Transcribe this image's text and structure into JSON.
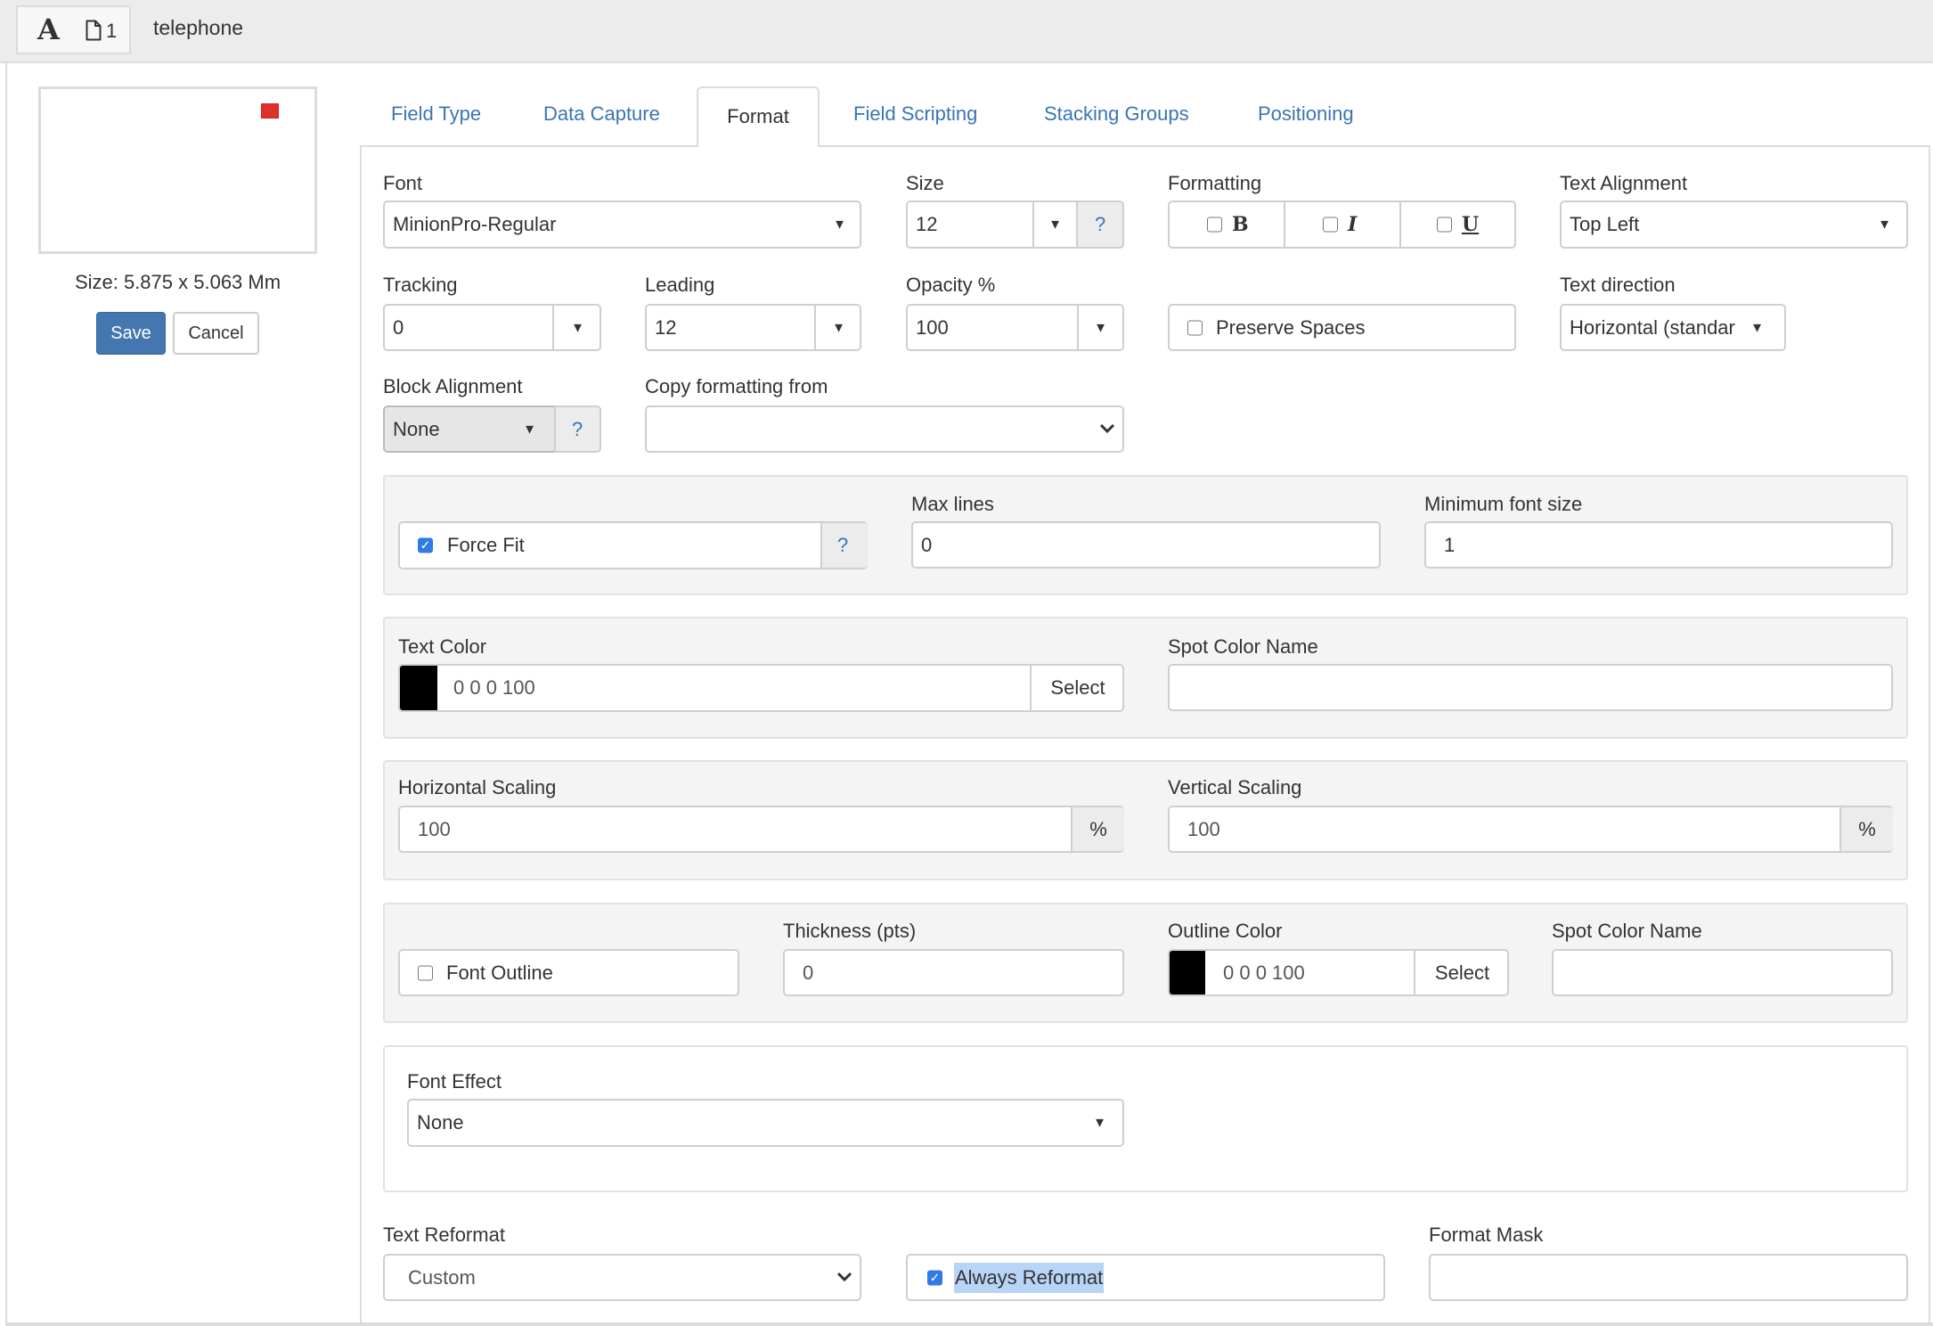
{
  "header": {
    "type_icon": "text-type-icon",
    "page_icon": "page-icon",
    "page_count": "1",
    "field_name": "telephone"
  },
  "sidebar": {
    "size_text": "Size: 5.875 x 5.063 Mm",
    "save_label": "Save",
    "cancel_label": "Cancel",
    "preview_mark_color": "#e0302a"
  },
  "tabs": [
    {
      "label": "Field Type",
      "active": false
    },
    {
      "label": "Data Capture",
      "active": false
    },
    {
      "label": "Format",
      "active": true
    },
    {
      "label": "Field Scripting",
      "active": false
    },
    {
      "label": "Stacking Groups",
      "active": false
    },
    {
      "label": "Positioning",
      "active": false
    }
  ],
  "format": {
    "font": {
      "label": "Font",
      "value": "MinionPro-Regular"
    },
    "size": {
      "label": "Size",
      "value": "12",
      "help": "?"
    },
    "formatting": {
      "label": "Formatting",
      "bold": {
        "glyph": "B",
        "checked": false
      },
      "italic": {
        "glyph": "I",
        "checked": false
      },
      "underline": {
        "glyph": "U",
        "checked": false
      }
    },
    "text_alignment": {
      "label": "Text Alignment",
      "value": "Top Left"
    },
    "tracking": {
      "label": "Tracking",
      "value": "0"
    },
    "leading": {
      "label": "Leading",
      "value": "12"
    },
    "opacity": {
      "label": "Opacity %",
      "value": "100"
    },
    "preserve_spaces": {
      "label": "Preserve Spaces",
      "checked": false
    },
    "text_direction": {
      "label": "Text direction",
      "value": "Horizontal (standar"
    },
    "block_alignment": {
      "label": "Block Alignment",
      "value": "None",
      "help": "?"
    },
    "copy_formatting": {
      "label": "Copy formatting from",
      "value": ""
    },
    "force_fit": {
      "label": "Force Fit",
      "checked": true,
      "help": "?"
    },
    "max_lines": {
      "label": "Max lines",
      "value": "0"
    },
    "min_font_size": {
      "label": "Minimum font size",
      "value": "1"
    },
    "text_color": {
      "label": "Text Color",
      "value": "0 0 0 100",
      "swatch": "#000000",
      "select_label": "Select"
    },
    "spot_color_name": {
      "label": "Spot Color Name",
      "value": ""
    },
    "horizontal_scaling": {
      "label": "Horizontal Scaling",
      "value": "100",
      "unit": "%"
    },
    "vertical_scaling": {
      "label": "Vertical Scaling",
      "value": "100",
      "unit": "%"
    },
    "font_outline": {
      "label": "Font Outline",
      "checked": false
    },
    "thickness": {
      "label": "Thickness (pts)",
      "value": "0"
    },
    "outline_color": {
      "label": "Outline Color",
      "value": "0 0 0 100",
      "swatch": "#000000",
      "select_label": "Select"
    },
    "outline_spot_color_name": {
      "label": "Spot Color Name",
      "value": ""
    },
    "font_effect": {
      "label": "Font Effect",
      "value": "None"
    },
    "text_reformat": {
      "label": "Text Reformat",
      "value": "Custom"
    },
    "always_reformat": {
      "label": "Always Reformat",
      "checked": true
    },
    "format_mask": {
      "label": "Format Mask",
      "value": ""
    }
  },
  "colors": {
    "accent": "#3a74b5",
    "primary_button": "#4476b0",
    "checkbox": "#2f7ae5"
  }
}
